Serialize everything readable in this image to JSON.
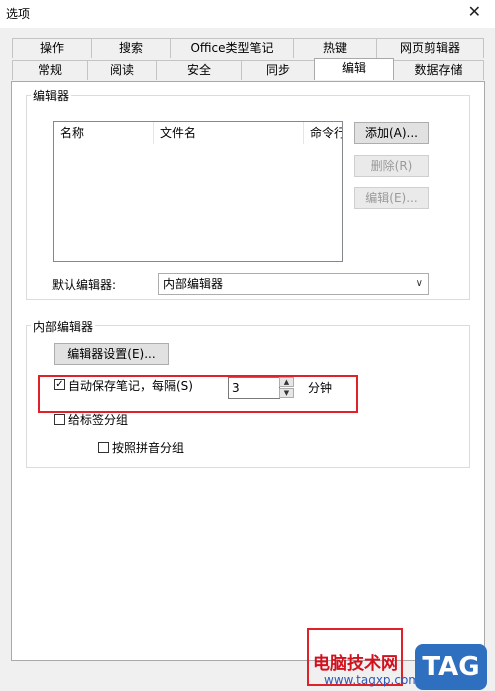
{
  "window": {
    "title": "选项"
  },
  "tabs": {
    "row1": [
      {
        "label": "操作"
      },
      {
        "label": "搜索"
      },
      {
        "label": "Office类型笔记"
      },
      {
        "label": "热键"
      },
      {
        "label": "网页剪辑器"
      }
    ],
    "row2": [
      {
        "label": "常规"
      },
      {
        "label": "阅读"
      },
      {
        "label": "安全"
      },
      {
        "label": "同步"
      },
      {
        "label": "编辑"
      },
      {
        "label": "数据存储"
      }
    ],
    "active": "编辑"
  },
  "editors_group": {
    "label": "编辑器",
    "columns": [
      "名称",
      "文件名",
      "命令行"
    ],
    "buttons": {
      "add": "添加(A)...",
      "delete": "删除(R)",
      "edit": "编辑(E)..."
    },
    "default_editor_label": "默认编辑器:",
    "default_editor_value": "内部编辑器"
  },
  "internal_editor_group": {
    "label": "内部编辑器",
    "settings_button": "编辑器设置(E)...",
    "autosave": {
      "checked": true,
      "label": "自动保存笔记，每隔(S)",
      "value": "3",
      "unit": "分钟"
    },
    "group_by_tag": {
      "checked": false,
      "label": "给标签分组"
    },
    "group_by_pinyin": {
      "checked": false,
      "label": "按照拼音分组"
    }
  },
  "watermark": {
    "site_name": "电脑技术网",
    "url": "www.tagxp.com",
    "logo": "TAG"
  },
  "colors": {
    "highlight_red": "#e0212a",
    "dialog_bg": "#f0f0f0",
    "panel_bg": "#ffffff",
    "logo_blue": "#2f6fbf"
  }
}
